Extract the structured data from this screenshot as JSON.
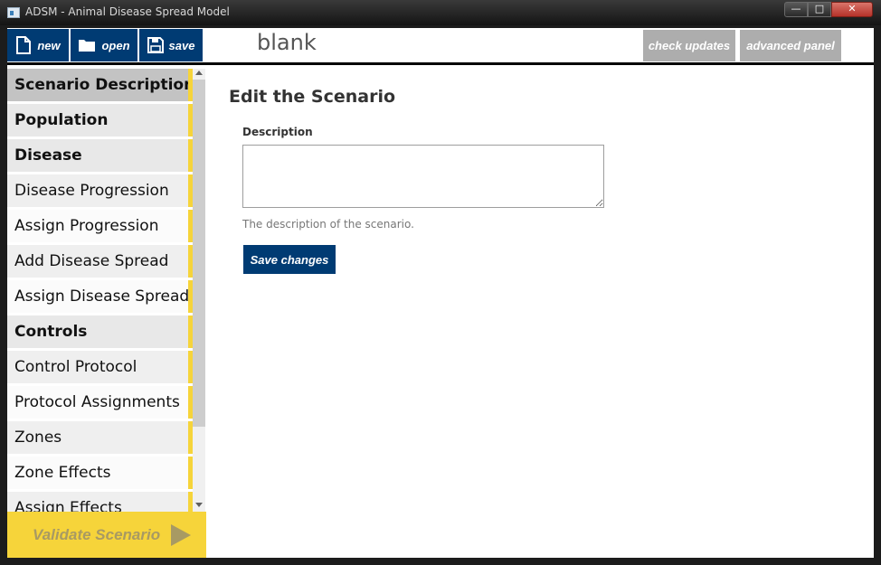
{
  "window": {
    "title": "ADSM - Animal Disease Spread Model",
    "min_glyph": "—",
    "max_glyph": "□",
    "close_glyph": "✕"
  },
  "toolbar": {
    "new_label": "new",
    "open_label": "open",
    "save_label": "save",
    "scenario_name": "blank",
    "check_updates_label": "check updates",
    "advanced_panel_label": "advanced panel"
  },
  "sidebar": {
    "items": [
      {
        "label": "Scenario Description",
        "kind": "section",
        "active": true
      },
      {
        "label": "Population",
        "kind": "section"
      },
      {
        "label": "Disease",
        "kind": "section"
      },
      {
        "label": "Disease Progression",
        "kind": "sub"
      },
      {
        "label": "Assign Progression",
        "kind": "alt"
      },
      {
        "label": "Add Disease Spread",
        "kind": "sub"
      },
      {
        "label": "Assign Disease Spread",
        "kind": "alt"
      },
      {
        "label": "Controls",
        "kind": "section"
      },
      {
        "label": "Control Protocol",
        "kind": "sub"
      },
      {
        "label": "Protocol Assignments",
        "kind": "alt"
      },
      {
        "label": "Zones",
        "kind": "sub"
      },
      {
        "label": "Zone Effects",
        "kind": "alt"
      },
      {
        "label": "Assign Effects",
        "kind": "sub"
      }
    ],
    "validate_label": "Validate Scenario"
  },
  "main": {
    "heading": "Edit the Scenario",
    "description_label": "Description",
    "description_value": "",
    "help_text": "The description of the scenario.",
    "save_button_label": "Save changes"
  },
  "colors": {
    "primary": "#003b73",
    "accent_yellow": "#f6d43a",
    "gray_button": "#adadad"
  }
}
